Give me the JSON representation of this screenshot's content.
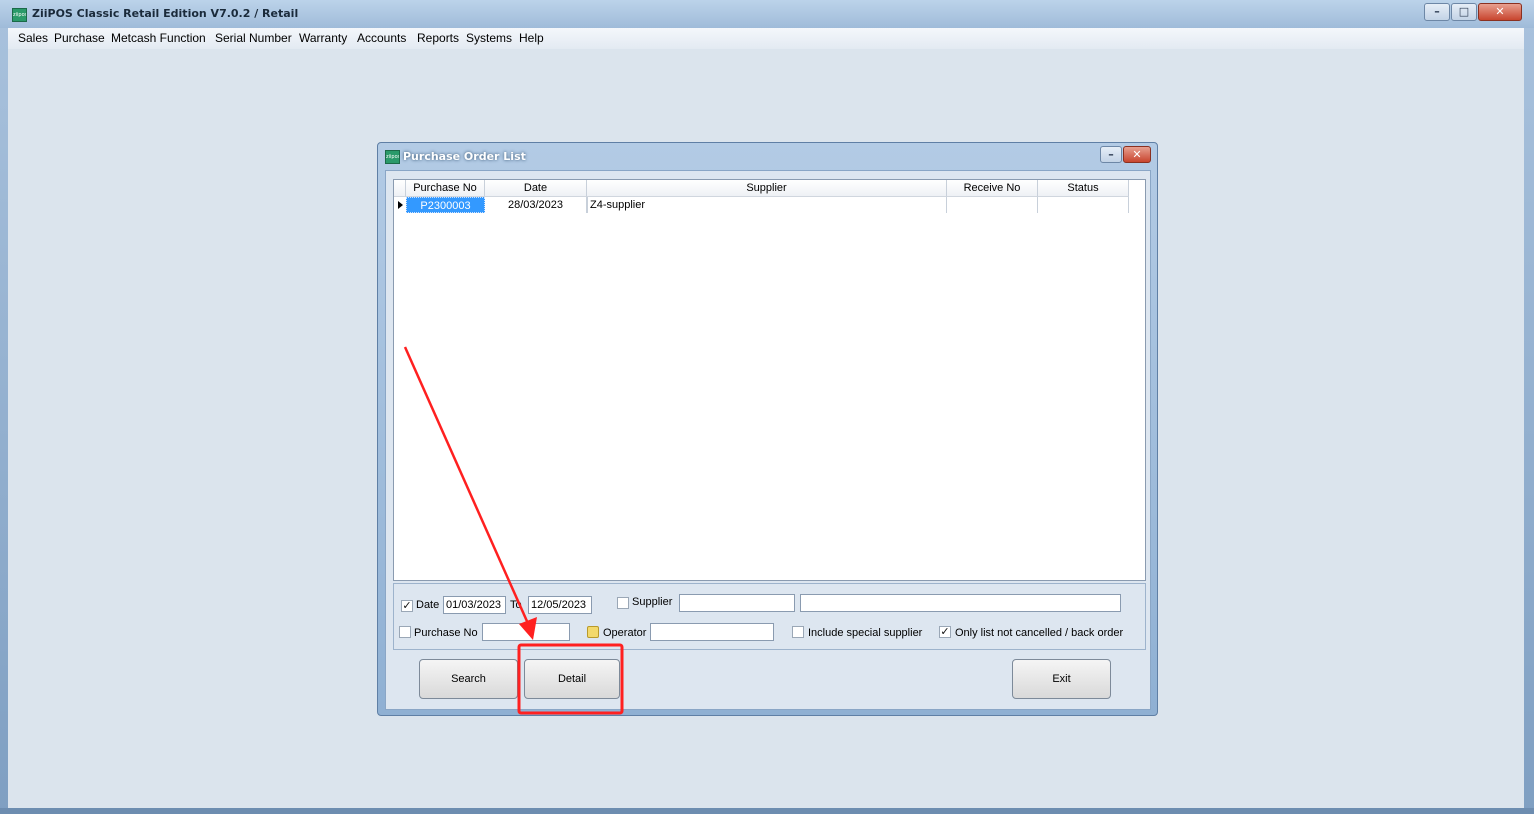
{
  "app": {
    "title": "ZiiPOS Classic Retail Edition V7.0.2 / Retail",
    "icon_text": "ziipos"
  },
  "menu": [
    "Sales",
    "Purchase",
    "Metcash Function",
    "Serial Number",
    "Warranty",
    "Accounts",
    "Reports",
    "Systems",
    "Help"
  ],
  "window_controls": {
    "minimize": "–",
    "maximize": "□",
    "close": "✕"
  },
  "dialog": {
    "title": "Purchase Order List",
    "icon_text": "ziipos",
    "columns": [
      "Purchase No",
      "Date",
      "Supplier",
      "Receive No",
      "Status"
    ],
    "rows": [
      {
        "purchase_no": "P2300003",
        "date": "28/03/2023",
        "supplier": "Z4-supplier",
        "receive_no": "",
        "status": ""
      }
    ],
    "filters": {
      "date_label": "Date",
      "date_checked": true,
      "date_from": "01/03/2023",
      "to_label": "To",
      "date_to": "12/05/2023",
      "supplier_label": "Supplier",
      "supplier_checked": false,
      "supplier_code": "",
      "supplier_name": "",
      "purchase_no_label": "Purchase No",
      "purchase_no_checked": false,
      "purchase_no_value": "",
      "operator_label": "Operator",
      "operator_value": "",
      "include_special_label": "Include special supplier",
      "include_special_checked": false,
      "only_list_label": "Only list not cancelled / back order",
      "only_list_checked": true
    },
    "buttons": {
      "search": "Search",
      "detail": "Detail",
      "exit": "Exit"
    }
  },
  "colors": {
    "highlight": "#3399ff",
    "annotation": "#ff2020"
  }
}
